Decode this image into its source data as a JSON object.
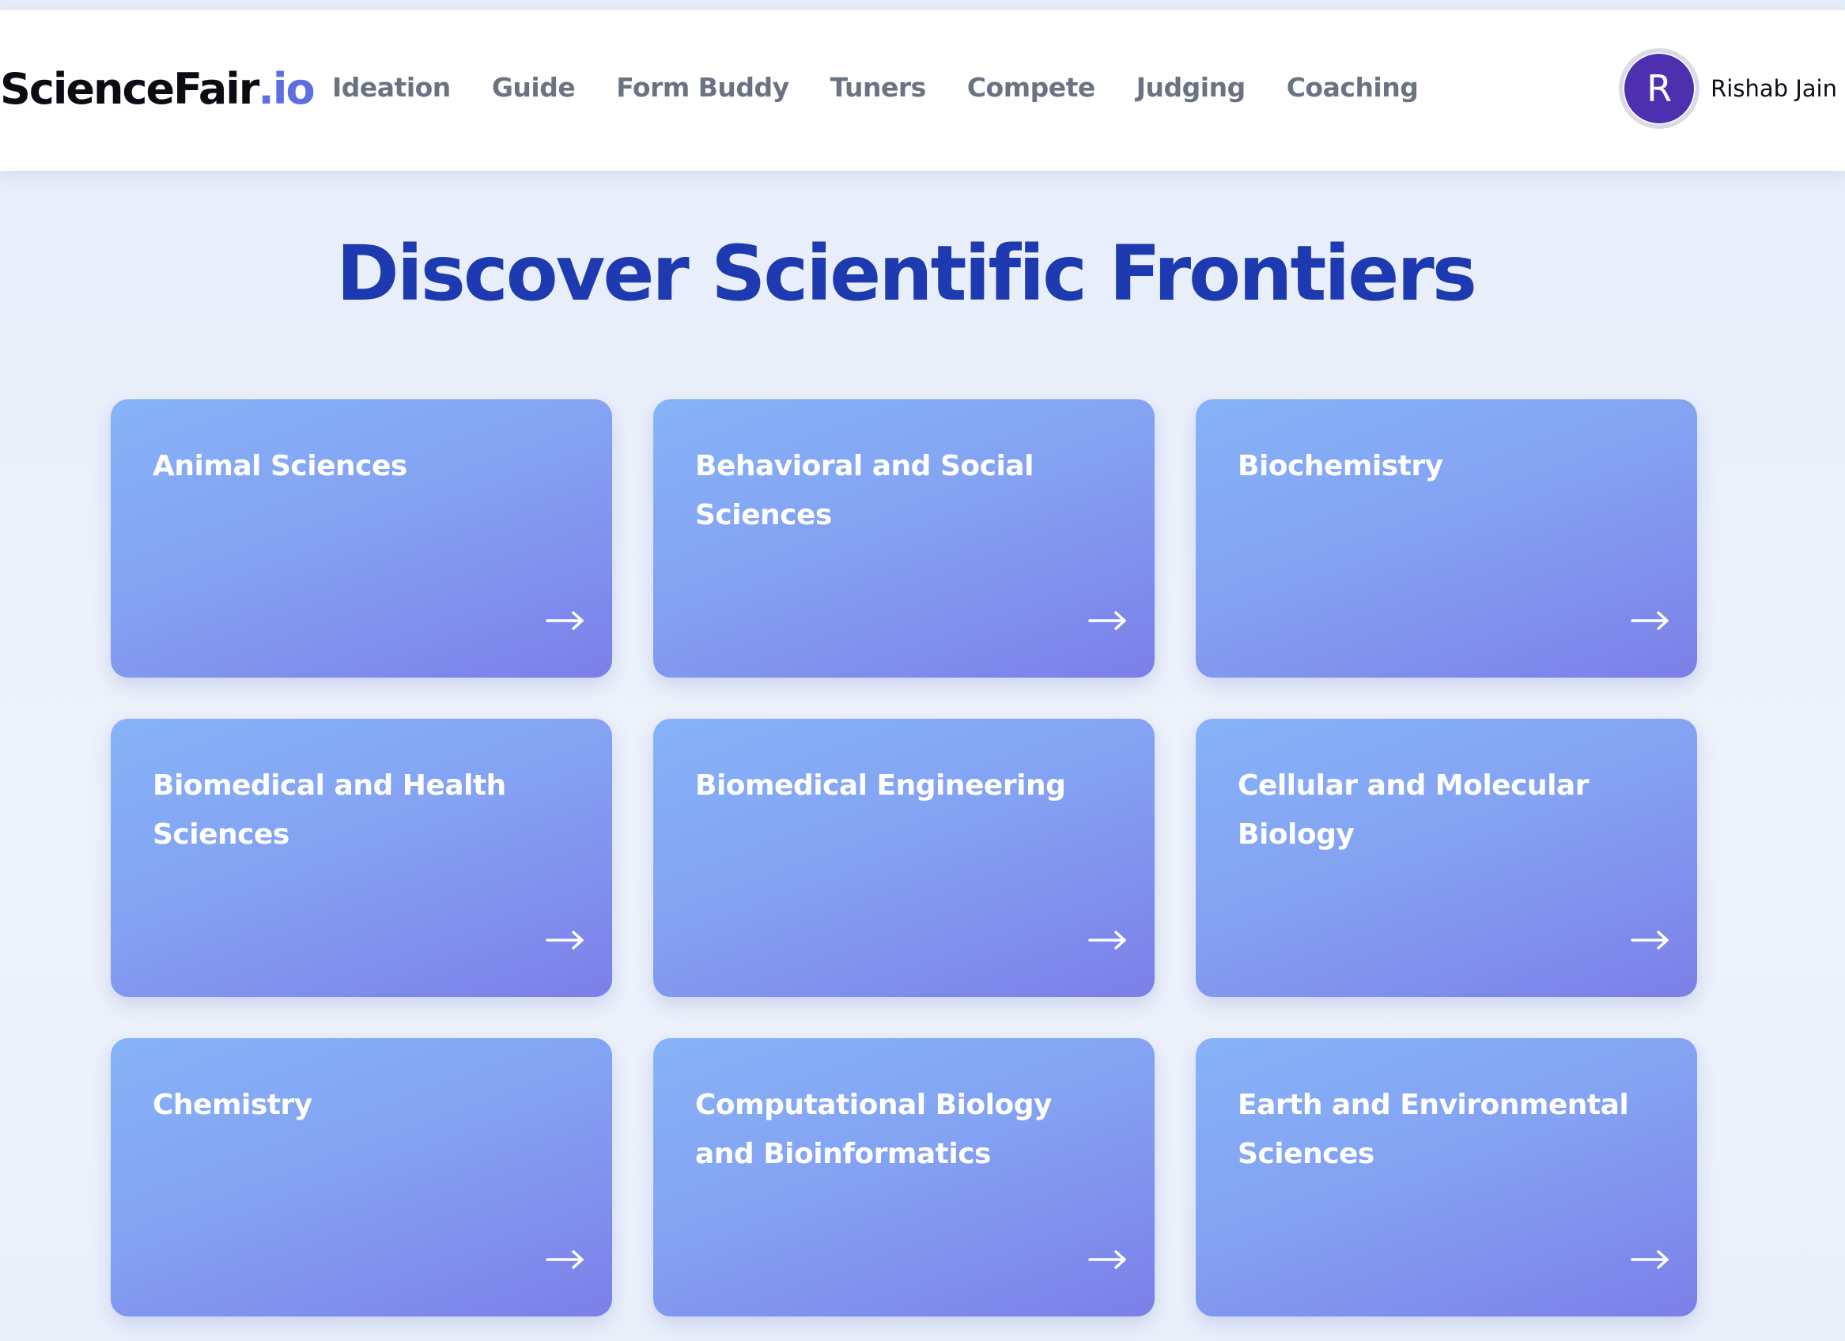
{
  "brand": {
    "name": "ScienceFair",
    "suffix": ".io"
  },
  "nav": {
    "items": [
      {
        "label": "Ideation"
      },
      {
        "label": "Guide"
      },
      {
        "label": "Form Buddy"
      },
      {
        "label": "Tuners"
      },
      {
        "label": "Compete"
      },
      {
        "label": "Judging"
      },
      {
        "label": "Coaching"
      }
    ]
  },
  "user": {
    "initial": "R",
    "name": "Rishab Jain",
    "avatar_color": "#4e2fb0"
  },
  "main": {
    "title": "Discover Scientific Frontiers",
    "cards": [
      {
        "label": "Animal Sciences",
        "icon": "arrow-right-icon"
      },
      {
        "label": "Behavioral and Social Sciences",
        "icon": "arrow-right-icon"
      },
      {
        "label": "Biochemistry",
        "icon": "arrow-right-icon"
      },
      {
        "label": "Biomedical and Health Sciences",
        "icon": "arrow-right-icon"
      },
      {
        "label": "Biomedical Engineering",
        "icon": "arrow-right-icon"
      },
      {
        "label": "Cellular and Molecular Biology",
        "icon": "arrow-right-icon"
      },
      {
        "label": "Chemistry",
        "icon": "arrow-right-icon"
      },
      {
        "label": "Computational Biology and Bioinformatics",
        "icon": "arrow-right-icon"
      },
      {
        "label": "Earth and Environmental Sciences",
        "icon": "arrow-right-icon"
      }
    ]
  },
  "colors": {
    "title": "#1d3ab0",
    "card_gradient_start": "#86b3f8",
    "card_gradient_end": "#7c7fe8",
    "nav_text": "#6b7383",
    "brand_accent": "#5b6fe0"
  }
}
